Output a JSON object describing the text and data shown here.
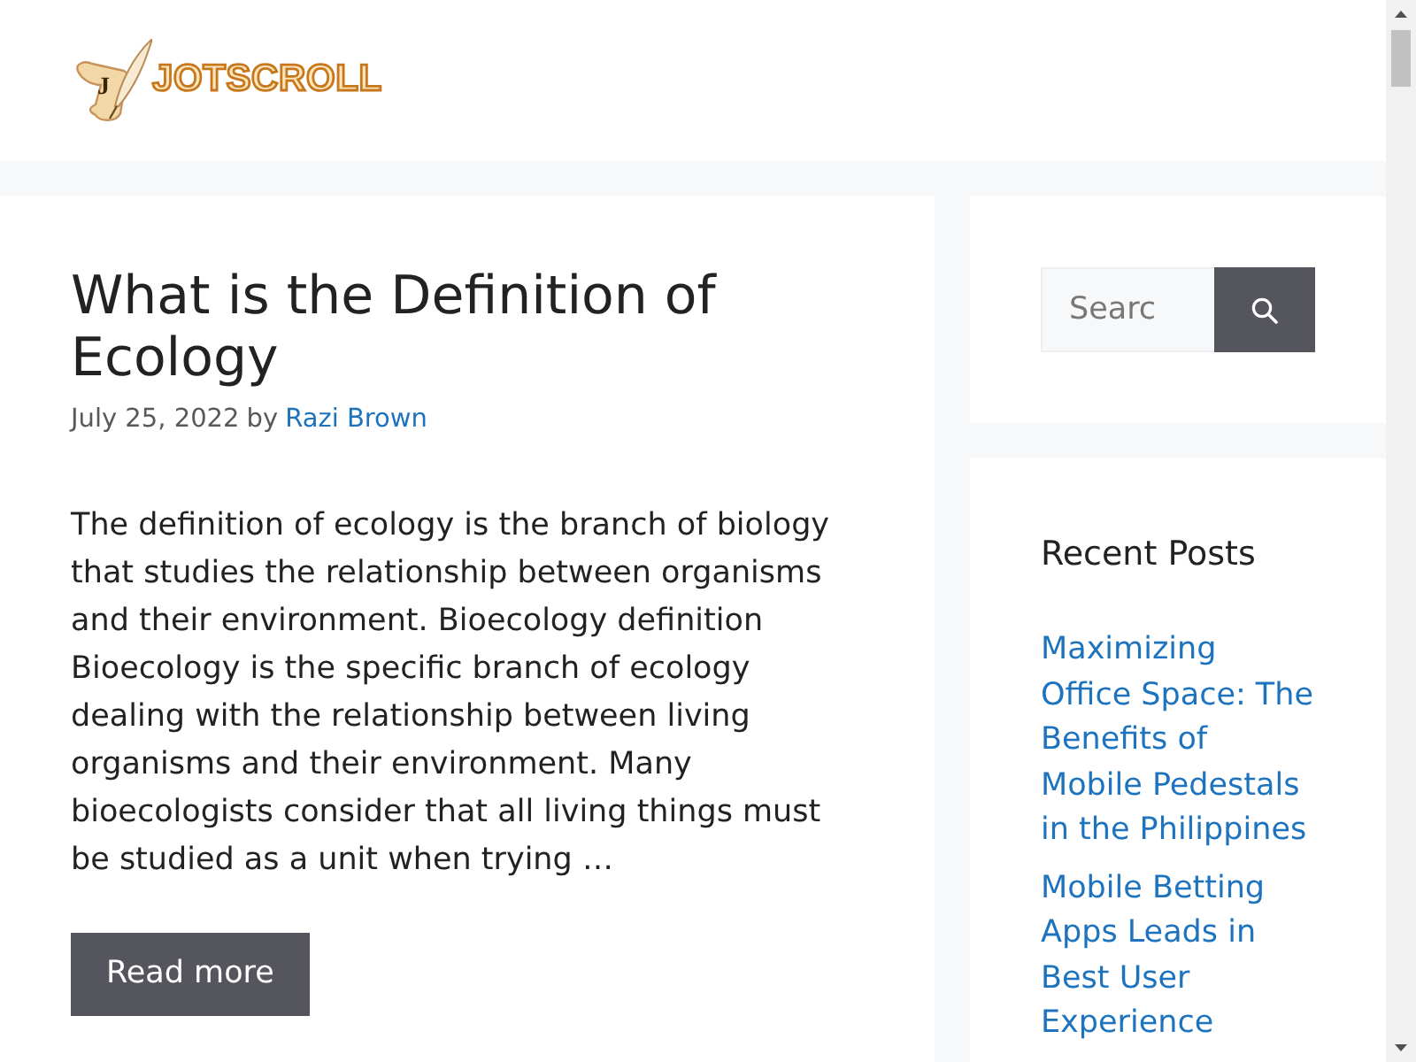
{
  "header": {
    "logo": {
      "monogram": "J",
      "wordmark": "JOTSCROLL"
    }
  },
  "article": {
    "title": "What is the Definition of Ecology",
    "date": "July 25, 2022",
    "byline": "by",
    "author": "Razi Brown",
    "excerpt": "The definition of ecology is the branch of biology that studies the relationship between organisms and their environment. Bioecology definition Bioecology is the specific branch of ecology dealing with the relationship between living organisms and their environment. Many bioecologists consider that all living things must be studied as a unit when trying …",
    "button": "Read more"
  },
  "sidebar": {
    "search": {
      "placeholder": "Searc"
    },
    "recent_posts": {
      "heading": "Recent Posts",
      "links": [
        "Maximizing Office Space: The Benefits of Mobile Pedestals in the Philippines",
        "Mobile Betting Apps Leads in Best User Experience"
      ]
    }
  }
}
